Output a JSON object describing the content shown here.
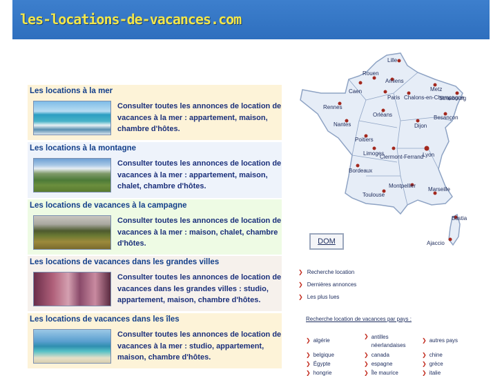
{
  "header": {
    "site_name": "les-locations-de-vacances.com"
  },
  "sections": [
    {
      "title": "Les locations à la mer",
      "description": "Consulter toutes les annonces de location de vacances à la mer : appartement, maison, chambre d'hôtes."
    },
    {
      "title": "Les locations à la montagne",
      "description": "Consulter toutes les annonces de location de vacances à la mer : appartement, maison, chalet, chambre d'hôtes."
    },
    {
      "title": "Les locations de vacances à la campagne",
      "description": "Consulter toutes les annonces de location de vacances à la mer : maison, chalet, chambre d'hôtes."
    },
    {
      "title": "Les locations de vacances dans les grandes villes",
      "description": "Consulter toutes les annonces de location de vacances dans les grandes villes : studio, appartement, maison, chambre d'hôtes."
    },
    {
      "title": "Les locations de vacances dans les îles",
      "description": "Consulter toutes les annonces de location de vacances à la mer : studio, appartement, maison, chambre d'hôtes."
    }
  ],
  "map": {
    "cities": [
      "Lille",
      "Rouen",
      "Amiens",
      "Caen",
      "Paris",
      "Chalons-en-Champagne",
      "Metz",
      "Strasbourg",
      "Rennes",
      "Orléans",
      "Besançon",
      "Nantes",
      "Dijon",
      "Poitiers",
      "Limoges",
      "Clermont-Ferrand",
      "Lyon",
      "Bordeaux",
      "Montpellier",
      "Marseille",
      "Toulouse",
      "Bastia",
      "Ajaccio"
    ],
    "dom_label": "DOM"
  },
  "links": [
    "Recherche location",
    "Dernières annonces",
    "Les plus lues"
  ],
  "countries": {
    "title": "Recherche location de vacances par pays :",
    "list": [
      "algérie",
      "antilles néerlandaises",
      "autres pays",
      "belgique",
      "canada",
      "chine",
      "Égypte",
      "espagne",
      "grèce",
      "hongrie",
      "Île maurice",
      "italie"
    ]
  }
}
